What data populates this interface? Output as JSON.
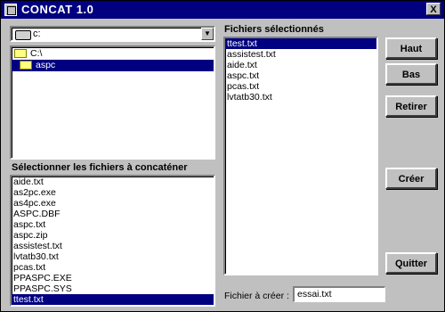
{
  "window": {
    "title": "CONCAT 1.0",
    "close_label": "X"
  },
  "drive": {
    "value": "c:",
    "arrow": "▼"
  },
  "directories": [
    "C:\\",
    "aspc"
  ],
  "files_label": "Sélectionner les fichiers à concaténer",
  "files": [
    "aide.txt",
    "as2pc.exe",
    "as4pc.exe",
    "ASPC.DBF",
    "aspc.txt",
    "aspc.zip",
    "assistest.txt",
    "lvtatb30.txt",
    "pcas.txt",
    "PPASPC.EXE",
    "PPASPC.SYS",
    "ttest.txt"
  ],
  "selected_label": "Fichiers sélectionnés",
  "selected_files": [
    "ttest.txt",
    "assistest.txt",
    "aide.txt",
    "aspc.txt",
    "pcas.txt",
    "lvtatb30.txt"
  ],
  "buttons": {
    "up": "Haut",
    "down": "Bas",
    "remove": "Retirer",
    "create": "Créer",
    "quit": "Quitter"
  },
  "output": {
    "label": "Fichier à créer :",
    "value": "essai.txt"
  }
}
